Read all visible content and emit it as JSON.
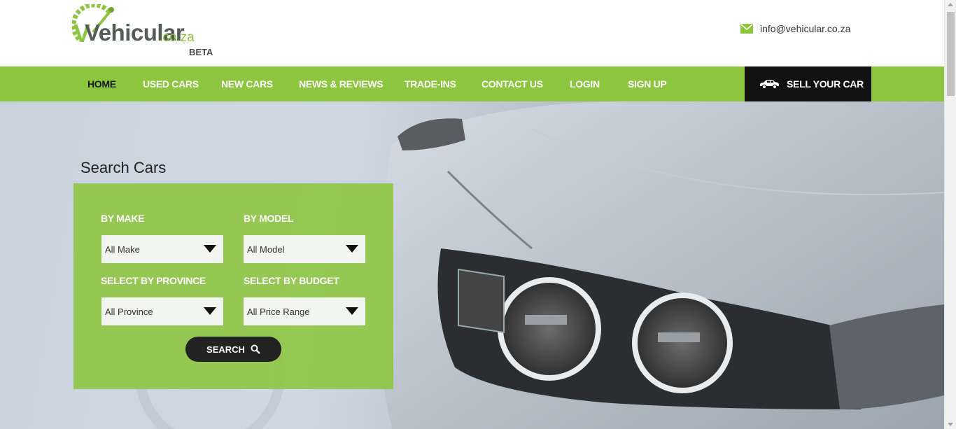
{
  "brand": {
    "logo_text": "Vehicular",
    "logo_domain": ".co.za",
    "beta_label": "BETA",
    "accent_color": "#8cc63f"
  },
  "contact": {
    "email": "info@vehicular.co.za",
    "icon": "envelope-icon"
  },
  "nav": {
    "items": [
      {
        "label": "HOME",
        "active": true
      },
      {
        "label": "USED CARS"
      },
      {
        "label": "NEW CARS"
      },
      {
        "label": "NEWS & REVIEWS"
      },
      {
        "label": "TRADE-INS"
      },
      {
        "label": "CONTACT US"
      },
      {
        "label": "LOGIN"
      },
      {
        "label": "SIGN UP"
      }
    ],
    "sell_label": "SELL YOUR CAR",
    "sell_icon": "car-icon"
  },
  "search": {
    "title": "Search Cars",
    "make_label": "BY MAKE",
    "make_value": "All Make",
    "model_label": "BY MODEL",
    "model_value": "All Model",
    "province_label": "SELECT BY PROVINCE",
    "province_value": "All Province",
    "budget_label": "SELECT BY BUDGET",
    "budget_value": "All Price Range",
    "button_label": "SEARCH",
    "button_icon": "search-icon"
  }
}
